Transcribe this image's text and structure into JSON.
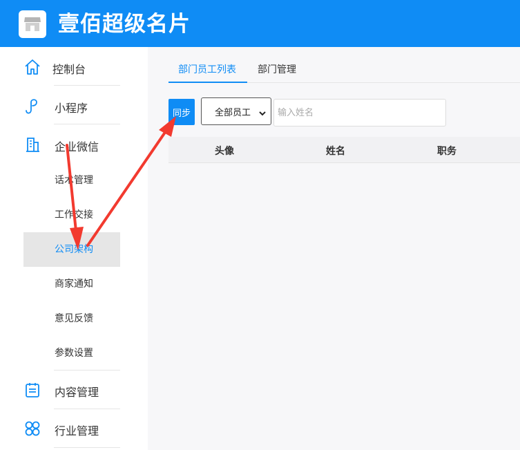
{
  "app": {
    "title": "壹佰超级名片",
    "logo_icon": "storefront-icon"
  },
  "colors": {
    "primary": "#0f8cf5",
    "annotation_arrow": "#f23a2f",
    "active_bg": "#e6e6e6"
  },
  "sidebar": {
    "items": [
      {
        "label": "控制台",
        "icon": "home-icon"
      },
      {
        "label": "小程序",
        "icon": "mini-program-icon"
      },
      {
        "label": "企业微信",
        "icon": "building-icon"
      },
      {
        "label": "内容管理",
        "icon": "calendar-list-icon"
      },
      {
        "label": "行业管理",
        "icon": "clover-grid-icon"
      }
    ],
    "sub_items": [
      {
        "label": "话术管理",
        "active": false
      },
      {
        "label": "工作交接",
        "active": false
      },
      {
        "label": "公司架构",
        "active": true
      },
      {
        "label": "商家通知",
        "active": false
      },
      {
        "label": "意见反馈",
        "active": false
      },
      {
        "label": "参数设置",
        "active": false
      }
    ]
  },
  "tabs": [
    {
      "label": "部门员工列表",
      "active": true
    },
    {
      "label": "部门管理",
      "active": false
    }
  ],
  "toolbar": {
    "sync_label": "同步",
    "dept_select": {
      "selected": "全部员工"
    },
    "name_input": {
      "value": "",
      "placeholder": "输入姓名"
    }
  },
  "table": {
    "columns": [
      "头像",
      "姓名",
      "职务"
    ],
    "rows": []
  }
}
